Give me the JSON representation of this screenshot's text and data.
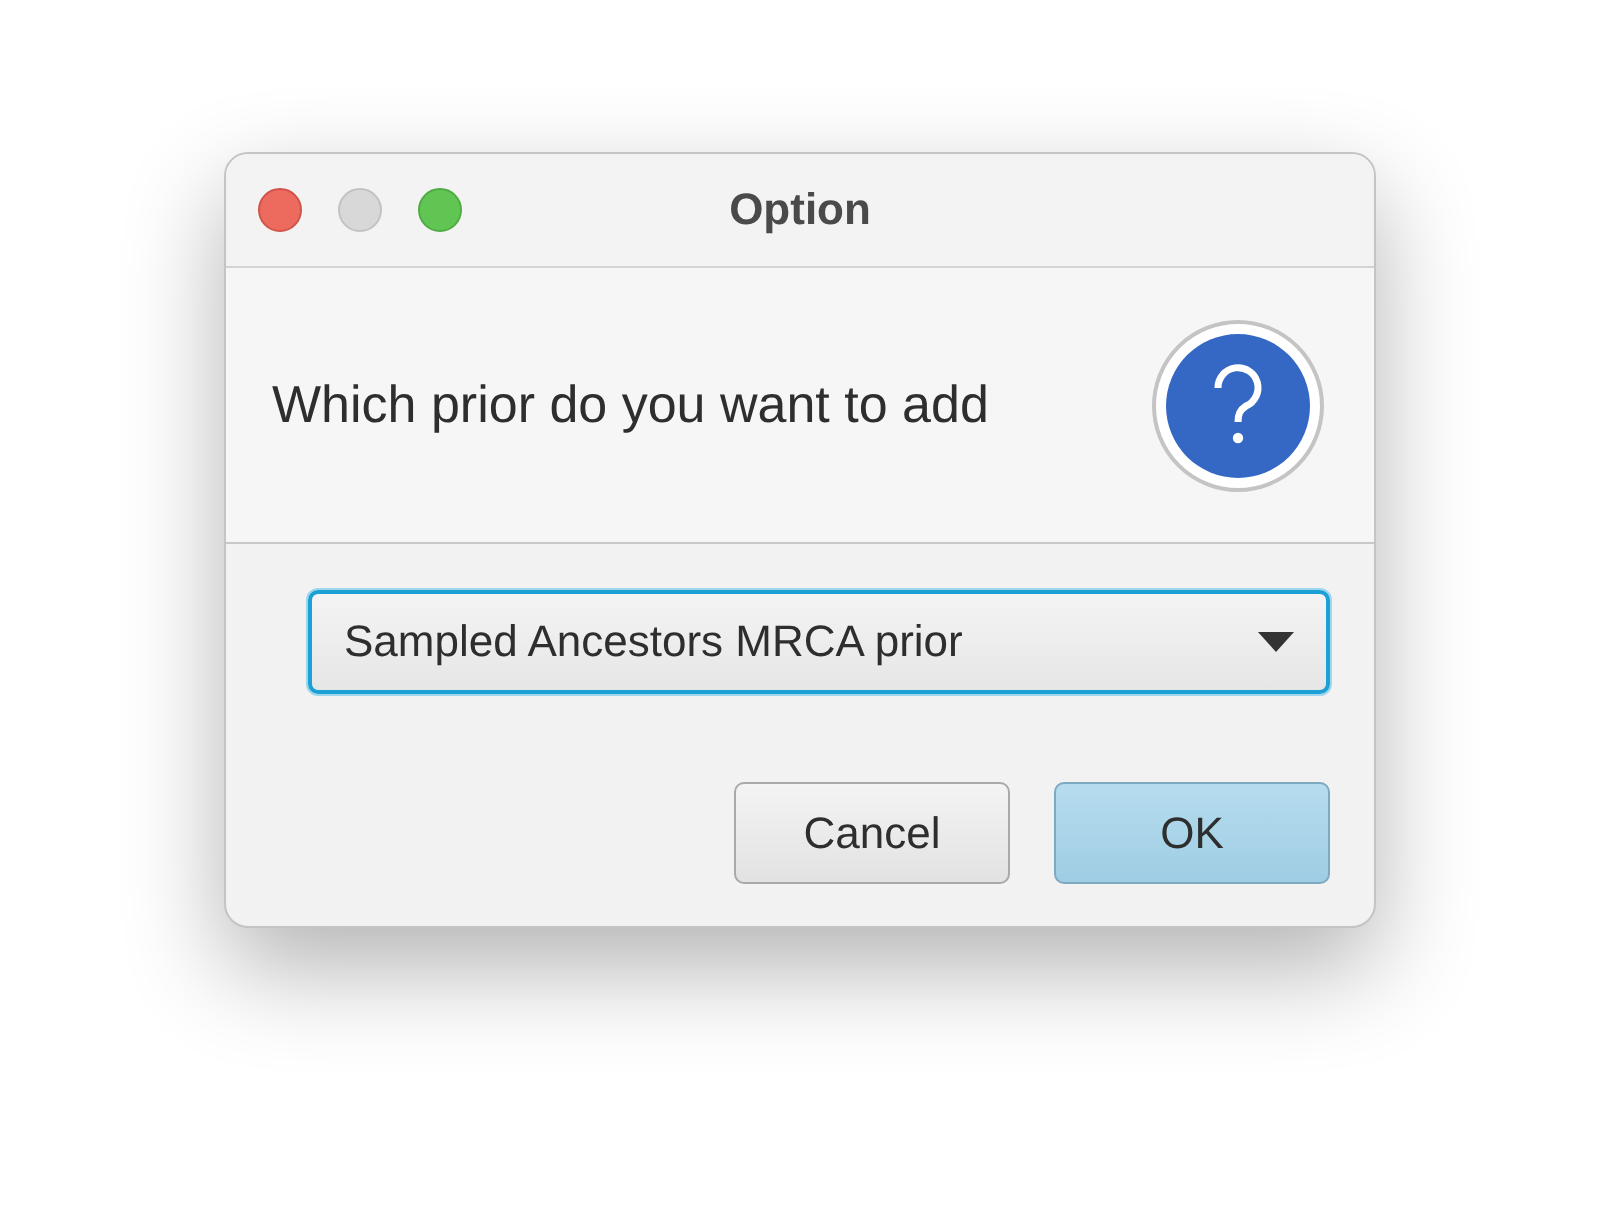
{
  "window": {
    "title": "Option"
  },
  "message": "Which prior do you want to add",
  "combo": {
    "value": "Sampled Ancestors MRCA prior"
  },
  "buttons": [
    {
      "label": "Cancel",
      "default": false
    },
    {
      "label": "OK",
      "default": true
    }
  ]
}
